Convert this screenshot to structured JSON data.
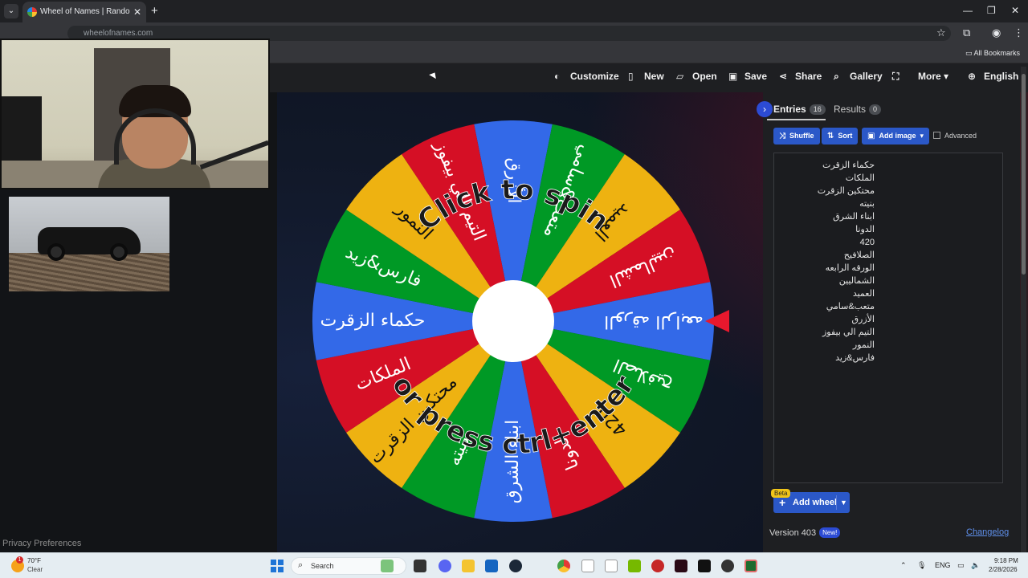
{
  "browser": {
    "tab_title": "Wheel of Names | Random name picker",
    "url": "wheelofnames.com",
    "bookmarks_label": "All Bookmarks"
  },
  "nav": {
    "customize": "Customize",
    "new": "New",
    "open": "Open",
    "save": "Save",
    "share": "Share",
    "gallery": "Gallery",
    "more": "More",
    "language": "English"
  },
  "wheel": {
    "top_text": "Click to spin",
    "bottom_text": "or press ctrl+enter",
    "segment_colors": [
      "#3369e8",
      "#009925",
      "#eeb211",
      "#d50f25"
    ],
    "segments": [
      "الأزرق",
      "متعب&سامي",
      "العميد",
      "الشماليين",
      "الورقه الرابعه",
      "الصلافيح",
      "420",
      "الدونا",
      "ابناء الشرق",
      "بنيته",
      "محتكين الزقرت",
      "الملكات",
      "حكماء الزقرت",
      "فارس&زيد",
      "النمور",
      "التيم الي بيفوز"
    ]
  },
  "sidebar": {
    "tab_entries": "Entries",
    "entries_count": "16",
    "tab_results": "Results",
    "results_count": "0",
    "shuffle": "Shuffle",
    "sort": "Sort",
    "add_image": "Add image",
    "advanced": "Advanced",
    "entries": [
      "حكماء الزقرت",
      "الملكات",
      "محتكين الزقرت",
      "بنيته",
      "ابناء الشرق",
      "الدونا",
      "420",
      "الصلافيح",
      "الورقه الرابعه",
      "الشماليين",
      "العميد",
      "متعب&سامي",
      "الأزرق",
      "التيم الي بيفوز",
      "النمور",
      "فارس&زيد"
    ],
    "beta": "Beta",
    "add_wheel": "Add wheel",
    "version": "Version 403",
    "new_badge": "New!",
    "changelog": "Changelog"
  },
  "footer": {
    "privacy": "Privacy Preferences"
  },
  "taskbar": {
    "weather_temp": "70°F",
    "weather_status": "Clear",
    "weather_badge": "1",
    "search_label": "Search",
    "lang": "ENG",
    "time": "9:18 PM",
    "date": "2/28/2026"
  }
}
